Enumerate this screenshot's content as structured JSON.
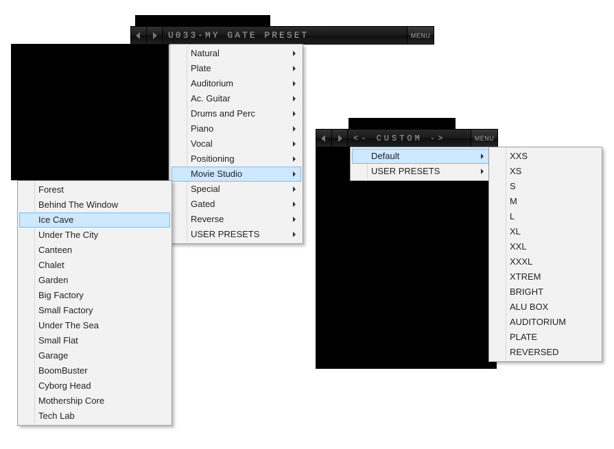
{
  "colors": {
    "highlight": "#cde8ff",
    "highlight_border": "#7abef0",
    "lcd_text": "#9aa0a0"
  },
  "display1": {
    "text": "U033-MY GATE PRESET",
    "menu_label": "MENU"
  },
  "display2": {
    "text": "<- CUSTOM ->",
    "menu_label": "MENU"
  },
  "menu1_categories": {
    "items": [
      {
        "label": "Natural",
        "has_sub": true,
        "selected": false
      },
      {
        "label": "Plate",
        "has_sub": true,
        "selected": false
      },
      {
        "label": "Auditorium",
        "has_sub": true,
        "selected": false
      },
      {
        "label": "Ac. Guitar",
        "has_sub": true,
        "selected": false
      },
      {
        "label": "Drums and Perc",
        "has_sub": true,
        "selected": false
      },
      {
        "label": "Piano",
        "has_sub": true,
        "selected": false
      },
      {
        "label": "Vocal",
        "has_sub": true,
        "selected": false
      },
      {
        "label": "Positioning",
        "has_sub": true,
        "selected": false
      },
      {
        "label": "Movie Studio",
        "has_sub": true,
        "selected": true
      },
      {
        "label": "Special",
        "has_sub": true,
        "selected": false
      },
      {
        "label": "Gated",
        "has_sub": true,
        "selected": false
      },
      {
        "label": "Reverse",
        "has_sub": true,
        "selected": false
      },
      {
        "label": "USER PRESETS",
        "has_sub": true,
        "selected": false
      }
    ]
  },
  "menu1_sub": {
    "items": [
      {
        "label": "Forest",
        "selected": false
      },
      {
        "label": "Behind The Window",
        "selected": false
      },
      {
        "label": "Ice Cave",
        "selected": true
      },
      {
        "label": "Under The City",
        "selected": false
      },
      {
        "label": "Canteen",
        "selected": false
      },
      {
        "label": "Chalet",
        "selected": false
      },
      {
        "label": "Garden",
        "selected": false
      },
      {
        "label": "Big Factory",
        "selected": false
      },
      {
        "label": "Small Factory",
        "selected": false
      },
      {
        "label": "Under The Sea",
        "selected": false
      },
      {
        "label": "Small Flat",
        "selected": false
      },
      {
        "label": "Garage",
        "selected": false
      },
      {
        "label": "BoomBuster",
        "selected": false
      },
      {
        "label": "Cyborg Head",
        "selected": false
      },
      {
        "label": "Mothership Core",
        "selected": false
      },
      {
        "label": "Tech Lab",
        "selected": false
      }
    ]
  },
  "menu2_categories": {
    "items": [
      {
        "label": "Default",
        "has_sub": true,
        "selected": true
      },
      {
        "label": "USER PRESETS",
        "has_sub": true,
        "selected": false
      }
    ]
  },
  "menu2_sub": {
    "items": [
      {
        "label": "XXS"
      },
      {
        "label": "XS"
      },
      {
        "label": "S"
      },
      {
        "label": "M"
      },
      {
        "label": "L"
      },
      {
        "label": "XL"
      },
      {
        "label": "XXL"
      },
      {
        "label": "XXXL"
      },
      {
        "label": "XTREM"
      },
      {
        "label": "BRIGHT"
      },
      {
        "label": "ALU BOX"
      },
      {
        "label": "AUDITORIUM"
      },
      {
        "label": "PLATE"
      },
      {
        "label": "REVERSED"
      }
    ]
  }
}
